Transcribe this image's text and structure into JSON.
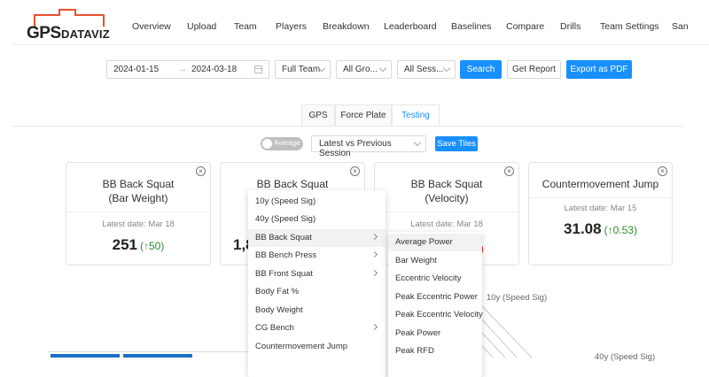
{
  "logo": {
    "gps": "GPS",
    "dataviz": "DATAVIZ"
  },
  "nav": [
    "Overview",
    "Upload",
    "Team",
    "Players",
    "Breakdown",
    "Leaderboard",
    "Baselines",
    "Compare",
    "Drills",
    "Team Settings",
    "San"
  ],
  "filters": {
    "start_date": "2024-01-15",
    "arrow": "→",
    "end_date": "2024-03-18",
    "team": "Full Team",
    "groups": "All Gro...",
    "sessions": "All Sess...",
    "search": "Search",
    "get_report": "Get Report",
    "export": "Export as PDF"
  },
  "tabs": [
    "GPS",
    "Force Plate",
    "Testing"
  ],
  "active_tab": "Testing",
  "controls": {
    "toggle_label": "Average",
    "comparison": "Latest vs Previous Session",
    "save_tiles": "Save Tiles"
  },
  "cards": [
    {
      "title_line1": "BB Back Squat",
      "title_line2": "(Bar Weight)",
      "date": "Latest date: Mar 18",
      "value": "251",
      "delta": "(↑50)",
      "close": "×"
    },
    {
      "title_line1": "BB Back Squat",
      "title_line2": "",
      "date": "",
      "value": "1,8",
      "delta": "",
      "close": "×"
    },
    {
      "title_line1": "BB Back Squat",
      "title_line2": "(Velocity)",
      "date": "Latest date: Mar 18",
      "value": "",
      "delta": ")",
      "close": "×"
    },
    {
      "title_line1": "Countermovement Jump",
      "title_line2": "",
      "date": "Latest date: Mar 15",
      "value": "31.08",
      "delta": "(↑0.53)",
      "close": "×"
    }
  ],
  "radar_labels": {
    "top": "10y (Speed Sig)",
    "right": "40y (Speed Sig)"
  },
  "menu_primary": [
    {
      "label": "10y (Speed Sig)",
      "submenu": false
    },
    {
      "label": "40y (Speed Sig)",
      "submenu": false
    },
    {
      "label": "BB Back Squat",
      "submenu": true
    },
    {
      "label": "BB Bench Press",
      "submenu": true
    },
    {
      "label": "BB Front Squat",
      "submenu": true
    },
    {
      "label": "Body Fat %",
      "submenu": false
    },
    {
      "label": "Body Weight",
      "submenu": false
    },
    {
      "label": "CG Bench",
      "submenu": true
    },
    {
      "label": "Countermovement Jump",
      "submenu": false
    }
  ],
  "menu_secondary": [
    "Average Power",
    "Bar Weight",
    "Eccentric Velocity",
    "Peak Eccentric Power",
    "Peak Eccentric Velocity",
    "Peak Power",
    "Peak RFD"
  ],
  "colors": {
    "primary": "#1890ff",
    "logo_accent": "#e8502e",
    "positive": "#2e8b2e",
    "negative": "#e02020"
  }
}
